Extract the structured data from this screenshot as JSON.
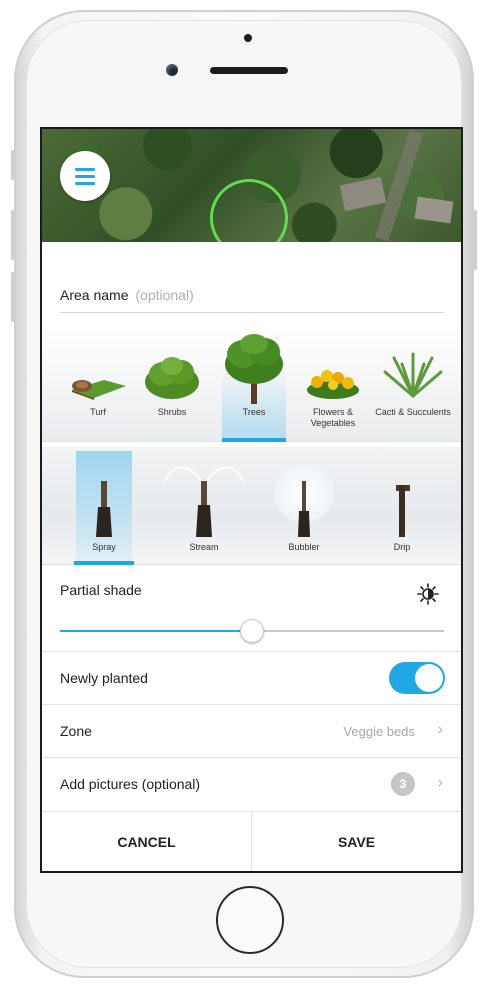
{
  "area_name": {
    "label": "Area name",
    "optional": "(optional)"
  },
  "plant_types": [
    {
      "label": "Turf",
      "icon": "turf-icon",
      "selected": false
    },
    {
      "label": "Shrubs",
      "icon": "shrubs-icon",
      "selected": false
    },
    {
      "label": "Trees",
      "icon": "tree-icon",
      "selected": true
    },
    {
      "label": "Flowers & Vegetables",
      "icon": "flowers-icon",
      "selected": false
    },
    {
      "label": "Cacti & Succulents",
      "icon": "cactus-icon",
      "selected": false
    }
  ],
  "sprinkler_heads": [
    {
      "label": "Spray",
      "icon": "spray-head-icon",
      "selected": true
    },
    {
      "label": "Stream",
      "icon": "stream-head-icon",
      "selected": false
    },
    {
      "label": "Bubbler",
      "icon": "bubbler-head-icon",
      "selected": false
    },
    {
      "label": "Drip",
      "icon": "drip-head-icon",
      "selected": false
    }
  ],
  "shade": {
    "label": "Partial shade",
    "level": 0.5,
    "icon": "sun-shade-icon"
  },
  "newly_planted": {
    "label": "Newly planted",
    "on": true
  },
  "zone": {
    "label": "Zone",
    "value": "Veggie beds"
  },
  "pictures": {
    "label": "Add pictures (optional)",
    "count": "3"
  },
  "actions": {
    "cancel": "CANCEL",
    "save": "SAVE"
  },
  "colors": {
    "accent": "#1fa7e6",
    "map_outline": "#5fe04a"
  }
}
